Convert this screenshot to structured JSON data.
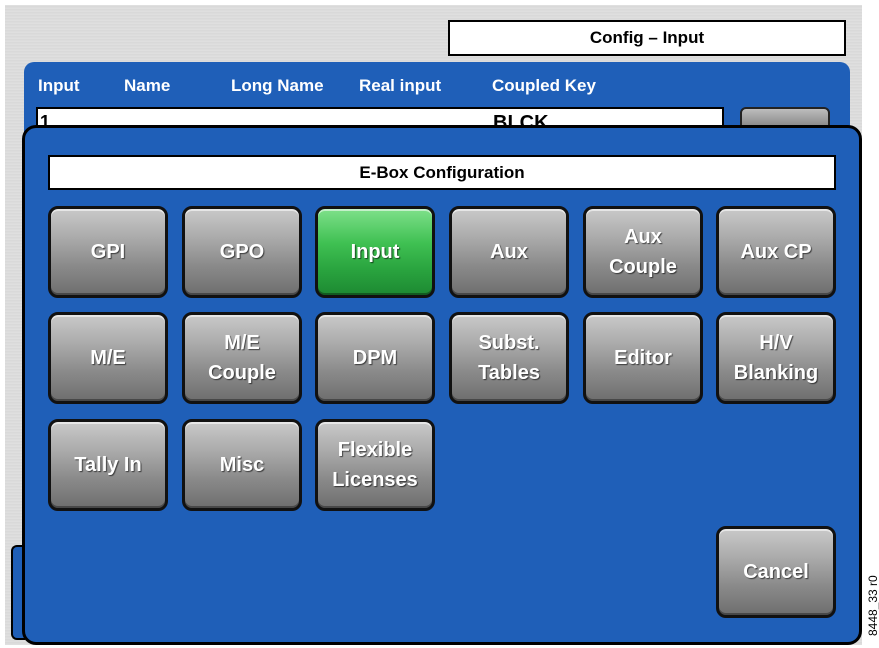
{
  "window": {
    "title": "Config – Input"
  },
  "table": {
    "headers": [
      "Input",
      "Name",
      "Long Name",
      "Real input",
      "Coupled Key"
    ],
    "row": {
      "number": "1",
      "source": "BLCK"
    }
  },
  "dialog": {
    "title": "E-Box Configuration",
    "buttons": [
      {
        "label": "GPI",
        "active": false
      },
      {
        "label": "GPO",
        "active": false
      },
      {
        "label": "Input",
        "active": true
      },
      {
        "label": "Aux",
        "active": false
      },
      {
        "label": "Aux\nCouple",
        "active": false
      },
      {
        "label": "Aux CP",
        "active": false
      },
      {
        "label": "M/E",
        "active": false
      },
      {
        "label": "M/E\nCouple",
        "active": false
      },
      {
        "label": "DPM",
        "active": false
      },
      {
        "label": "Subst.\nTables",
        "active": false
      },
      {
        "label": "Editor",
        "active": false
      },
      {
        "label": "H/V\nBlanking",
        "active": false
      },
      {
        "label": "Tally In",
        "active": false
      },
      {
        "label": "Misc",
        "active": false
      },
      {
        "label": "Flexible\nLicenses",
        "active": false
      }
    ],
    "cancel_label": "Cancel"
  },
  "figure_id": "8448_33 r0",
  "colors": {
    "panel_blue": "#1f5fb8",
    "active_green": "#3fc052",
    "button_gray": "#9a9a9a"
  }
}
